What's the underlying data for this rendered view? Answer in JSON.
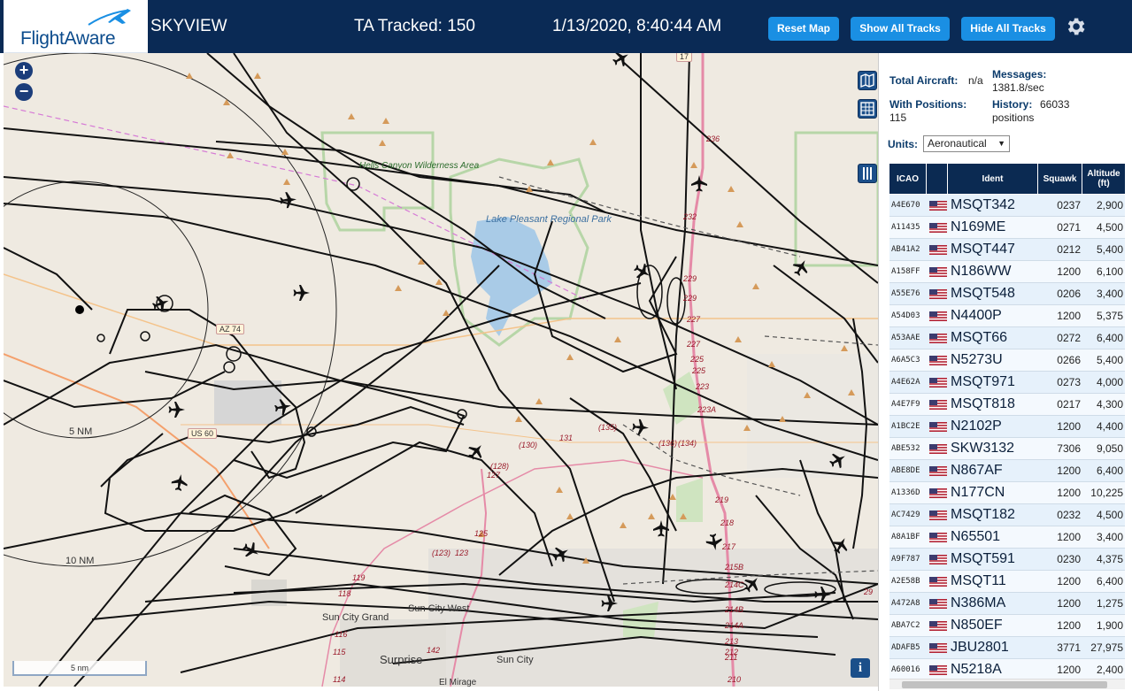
{
  "header": {
    "logo": "FlightAware",
    "title": "SKYVIEW",
    "tracked": "TA Tracked: 150",
    "datetime": "1/13/2020, 8:40:44 AM",
    "buttons": {
      "reset": "Reset Map",
      "show_all": "Show All Tracks",
      "hide_all": "Hide All Tracks"
    },
    "settings_icon": "gear-icon"
  },
  "map": {
    "zoom_in": "+",
    "zoom_out": "−",
    "scale_label": "5 nm",
    "info": "i",
    "range_rings": [
      "5 NM",
      "10 NM"
    ],
    "labels": {
      "hells_canyon": "Hells Canyon Wilderness Area",
      "lake_pleasant": "Lake Pleasant Regional Park",
      "sun_city_grand": "Sun City Grand",
      "sun_city_west": "Sun City West",
      "surprise": "Surprise",
      "sun_city": "Sun City",
      "el_mirage": "El Mirage",
      "az74": "AZ 74",
      "us60": "US 60",
      "i17": "17"
    },
    "route_numbers": [
      "236",
      "232",
      "229",
      "229",
      "227",
      "227",
      "225",
      "225",
      "223",
      "223A",
      "219",
      "218",
      "217",
      "215B",
      "214C",
      "214B",
      "214A",
      "213",
      "212",
      "211",
      "210",
      "(135)",
      "(130)",
      "(128)",
      "127",
      "125",
      "123",
      "(123)",
      "131",
      "119",
      "118",
      "116",
      "115",
      "114",
      "142",
      "(136)",
      "(134)",
      "29"
    ]
  },
  "panel": {
    "total_aircraft_label": "Total Aircraft:",
    "total_aircraft_value": "n/a",
    "messages_label": "Messages:",
    "messages_value": "1381.8/sec",
    "with_positions_label": "With Positions:",
    "with_positions_value": "115",
    "history_label": "History:",
    "history_value": "66033",
    "history_unit": "positions",
    "units_label": "Units:",
    "units_value": "Aeronautical",
    "table": {
      "headers": {
        "icao": "ICAO",
        "flag": "",
        "ident": "Ident",
        "squawk": "Squawk",
        "altitude": "Altitude (ft)"
      },
      "rows": [
        {
          "icao": "A4E670",
          "ident": "MSQT342",
          "squawk": "0237",
          "altitude": "2,900"
        },
        {
          "icao": "A11435",
          "ident": "N169ME",
          "squawk": "0271",
          "altitude": "4,500"
        },
        {
          "icao": "AB41A2",
          "ident": "MSQT447",
          "squawk": "0212",
          "altitude": "5,400"
        },
        {
          "icao": "A158FF",
          "ident": "N186WW",
          "squawk": "1200",
          "altitude": "6,100"
        },
        {
          "icao": "A55E76",
          "ident": "MSQT548",
          "squawk": "0206",
          "altitude": "3,400"
        },
        {
          "icao": "A54D03",
          "ident": "N4400P",
          "squawk": "1200",
          "altitude": "5,375"
        },
        {
          "icao": "A53AAE",
          "ident": "MSQT66",
          "squawk": "0272",
          "altitude": "6,400"
        },
        {
          "icao": "A6A5C3",
          "ident": "N5273U",
          "squawk": "0266",
          "altitude": "5,400"
        },
        {
          "icao": "A4E62A",
          "ident": "MSQT971",
          "squawk": "0273",
          "altitude": "4,000"
        },
        {
          "icao": "A4E7F9",
          "ident": "MSQT818",
          "squawk": "0217",
          "altitude": "4,300"
        },
        {
          "icao": "A1BC2E",
          "ident": "N2102P",
          "squawk": "1200",
          "altitude": "4,400"
        },
        {
          "icao": "ABE532",
          "ident": "SKW3132",
          "squawk": "7306",
          "altitude": "9,050"
        },
        {
          "icao": "ABE8DE",
          "ident": "N867AF",
          "squawk": "1200",
          "altitude": "6,400"
        },
        {
          "icao": "A1336D",
          "ident": "N177CN",
          "squawk": "1200",
          "altitude": "10,225"
        },
        {
          "icao": "AC7429",
          "ident": "MSQT182",
          "squawk": "0232",
          "altitude": "4,500"
        },
        {
          "icao": "A8A1BF",
          "ident": "N65501",
          "squawk": "1200",
          "altitude": "3,400"
        },
        {
          "icao": "A9F787",
          "ident": "MSQT591",
          "squawk": "0230",
          "altitude": "4,375"
        },
        {
          "icao": "A2E58B",
          "ident": "MSQT11",
          "squawk": "1200",
          "altitude": "6,400"
        },
        {
          "icao": "A472A8",
          "ident": "N386MA",
          "squawk": "1200",
          "altitude": "1,275"
        },
        {
          "icao": "ABA7C2",
          "ident": "N850EF",
          "squawk": "1200",
          "altitude": "1,900"
        },
        {
          "icao": "ADAFB5",
          "ident": "JBU2801",
          "squawk": "3771",
          "altitude": "27,975"
        },
        {
          "icao": "A60016",
          "ident": "N5218A",
          "squawk": "1200",
          "altitude": "2,400"
        }
      ]
    }
  },
  "colors": {
    "header_bg": "#0a2a55",
    "button": "#1a8fe3",
    "table_head": "#0b2a52",
    "row_odd": "#e6f1fb"
  }
}
